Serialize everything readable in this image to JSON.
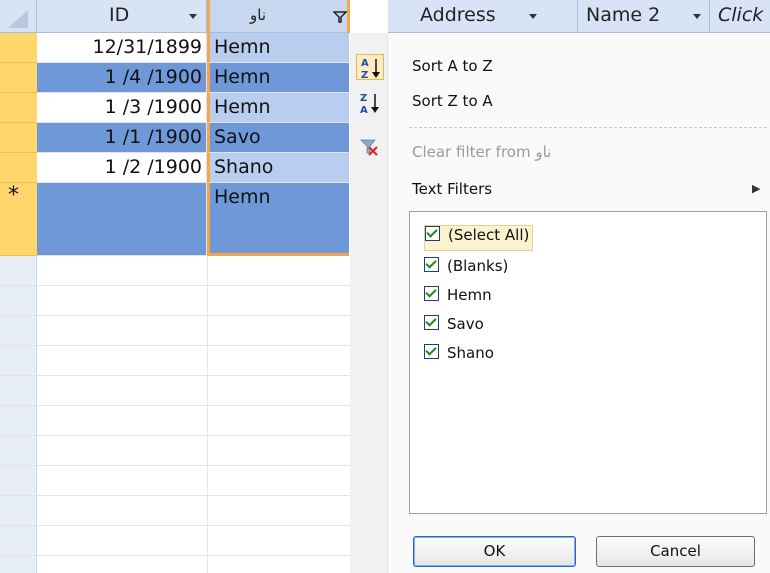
{
  "header": {
    "col_id": "ID",
    "col_name": "ناو",
    "col_address": "Address",
    "col_name2": "Name 2",
    "col_click": "Click"
  },
  "rows": [
    {
      "id": "12/31/1899",
      "name": "Hemn"
    },
    {
      "id": "1 /4 /1900",
      "name": "Hemn"
    },
    {
      "id": "1 /3 /1900",
      "name": "Hemn"
    },
    {
      "id": "1 /1 /1900",
      "name": "Savo"
    },
    {
      "id": "1 /2 /1900",
      "name": "Shano"
    }
  ],
  "new_row": {
    "marker": "*",
    "name": "Hemn"
  },
  "menu": {
    "sort_az": "Sort A to Z",
    "sort_za": "Sort Z to A",
    "clear_filter": "Clear filter from ناو",
    "text_filters": "Text Filters",
    "submenu_arrow": "▶"
  },
  "filter_list": [
    "(Select All)",
    "(Blanks)",
    "Hemn",
    "Savo",
    "Shano"
  ],
  "buttons": {
    "ok": "OK",
    "cancel": "Cancel"
  },
  "colors": {
    "selected_row": "#6e98d8",
    "row_selector": "#ffd66b",
    "header": "#d8e4f5"
  }
}
